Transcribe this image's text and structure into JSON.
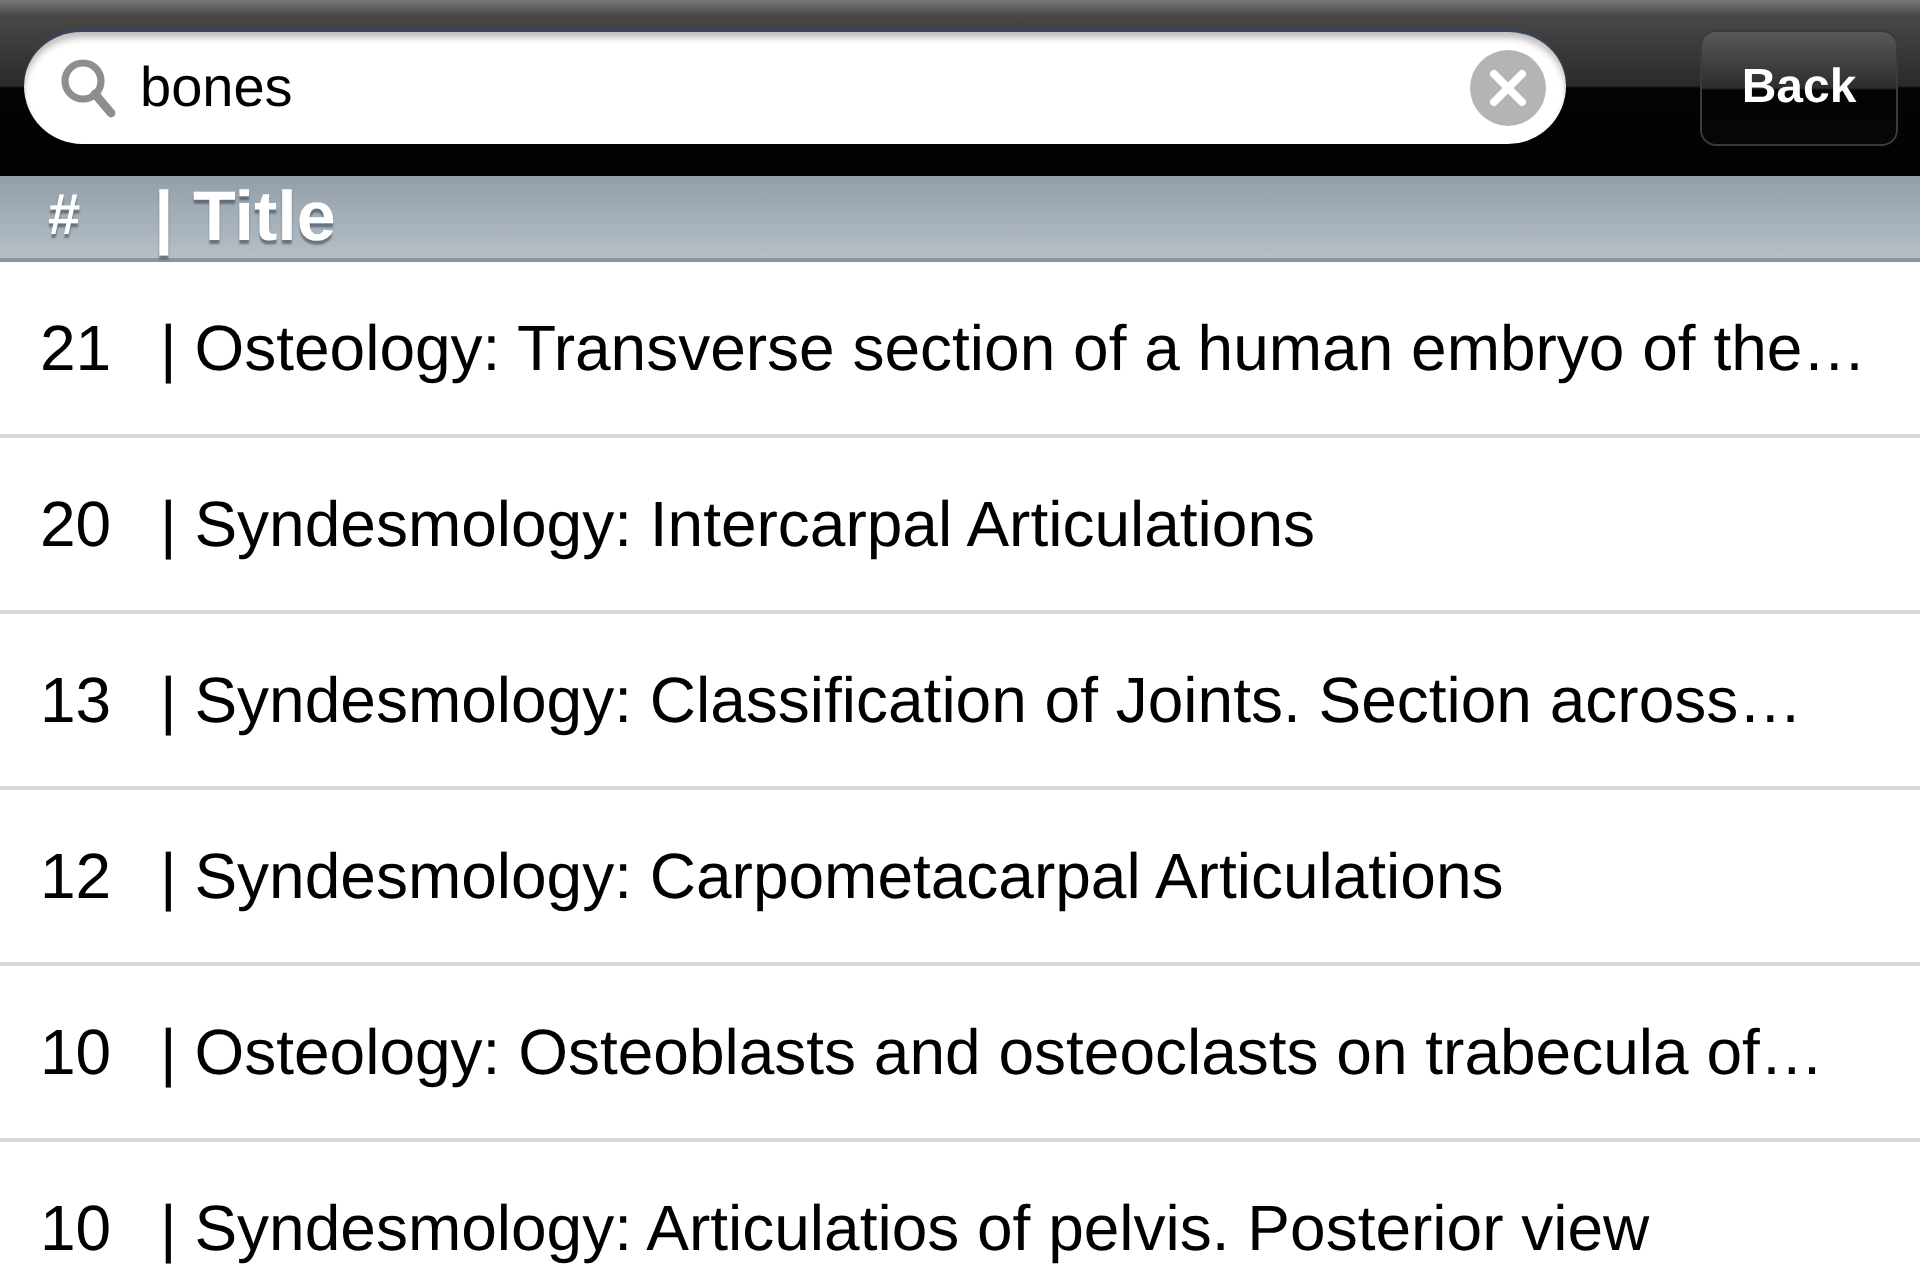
{
  "search": {
    "value": "bones"
  },
  "back_button": "Back",
  "columns": [
    "#",
    "| Title"
  ],
  "rows": [
    {
      "number": "21",
      "title": "| Osteology: Transverse section of a human embryo of the…"
    },
    {
      "number": "20",
      "title": "| Syndesmology: Intercarpal Articulations"
    },
    {
      "number": "13",
      "title": "| Syndesmology: Classification of Joints. Section across…"
    },
    {
      "number": "12",
      "title": "| Syndesmology: Carpometacarpal Articulations"
    },
    {
      "number": "10",
      "title": "| Osteology: Osteoblasts and osteoclasts on trabecula of…"
    },
    {
      "number": "10",
      "title": "| Syndesmology: Articulatios of pelvis. Posterior view"
    }
  ]
}
